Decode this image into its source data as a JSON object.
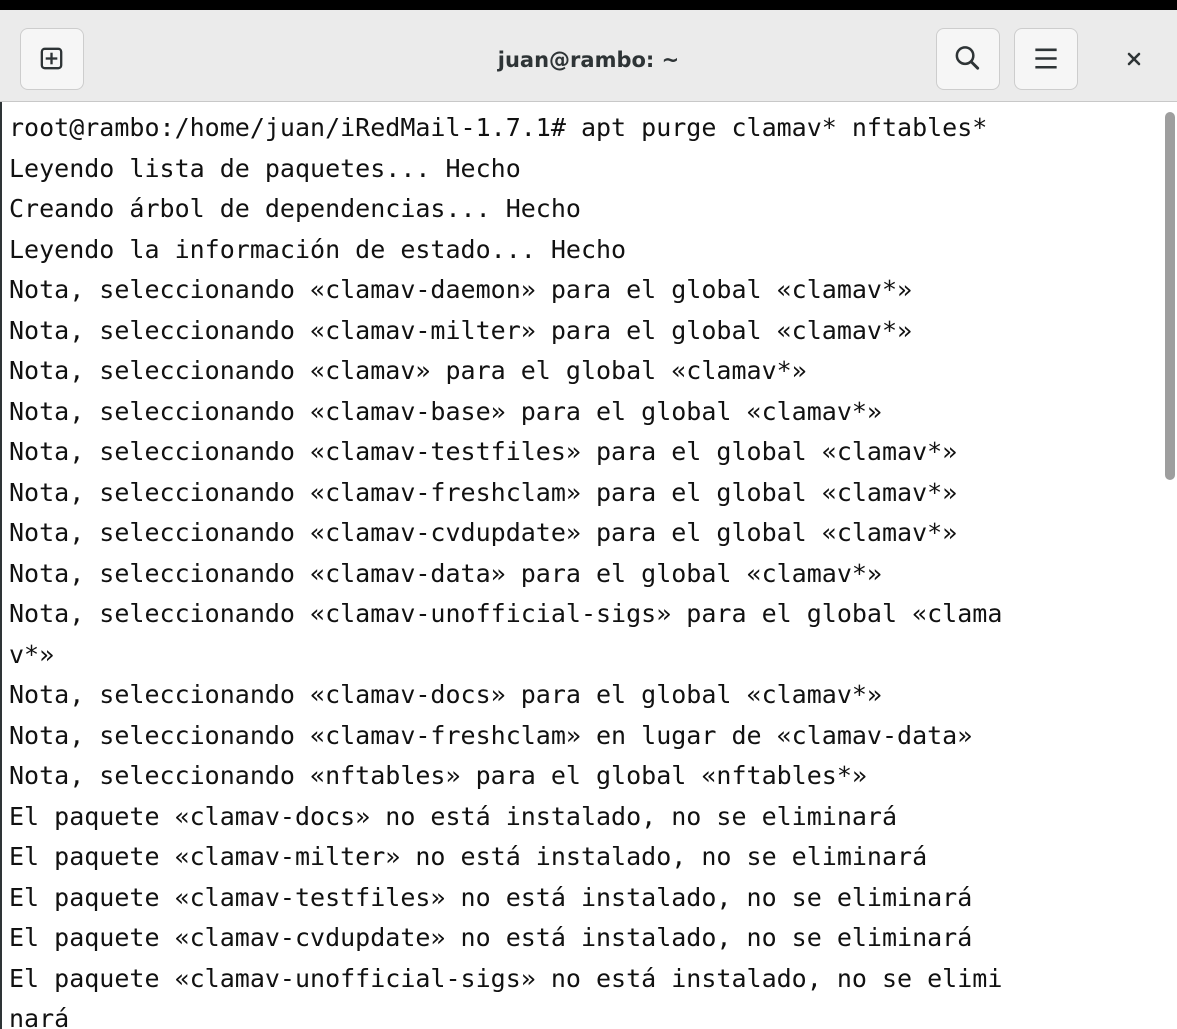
{
  "window": {
    "title": "juan@rambo: ~"
  },
  "header": {
    "new_tab_icon": "new-tab-icon",
    "search_icon": "search-icon",
    "menu_icon": "hamburger-menu-icon",
    "close_icon": "close-icon"
  },
  "terminal": {
    "lines": [
      "root@rambo:/home/juan/iRedMail-1.7.1# apt purge clamav* nftables*",
      "Leyendo lista de paquetes... Hecho",
      "Creando árbol de dependencias... Hecho",
      "Leyendo la información de estado... Hecho",
      "Nota, seleccionando «clamav-daemon» para el global «clamav*»",
      "Nota, seleccionando «clamav-milter» para el global «clamav*»",
      "Nota, seleccionando «clamav» para el global «clamav*»",
      "Nota, seleccionando «clamav-base» para el global «clamav*»",
      "Nota, seleccionando «clamav-testfiles» para el global «clamav*»",
      "Nota, seleccionando «clamav-freshclam» para el global «clamav*»",
      "Nota, seleccionando «clamav-cvdupdate» para el global «clamav*»",
      "Nota, seleccionando «clamav-data» para el global «clamav*»",
      "Nota, seleccionando «clamav-unofficial-sigs» para el global «clama",
      "v*»",
      "Nota, seleccionando «clamav-docs» para el global «clamav*»",
      "Nota, seleccionando «clamav-freshclam» en lugar de «clamav-data»",
      "Nota, seleccionando «nftables» para el global «nftables*»",
      "El paquete «clamav-docs» no está instalado, no se eliminará",
      "El paquete «clamav-milter» no está instalado, no se eliminará",
      "El paquete «clamav-testfiles» no está instalado, no se eliminará",
      "El paquete «clamav-cvdupdate» no está instalado, no se eliminará",
      "El paquete «clamav-unofficial-sigs» no está instalado, no se elimi",
      "nará"
    ]
  },
  "colors": {
    "header_bg": "#ebebeb",
    "terminal_bg": "#ffffff",
    "terminal_fg": "#111111",
    "scrollbar_thumb": "#9e9e9e"
  }
}
